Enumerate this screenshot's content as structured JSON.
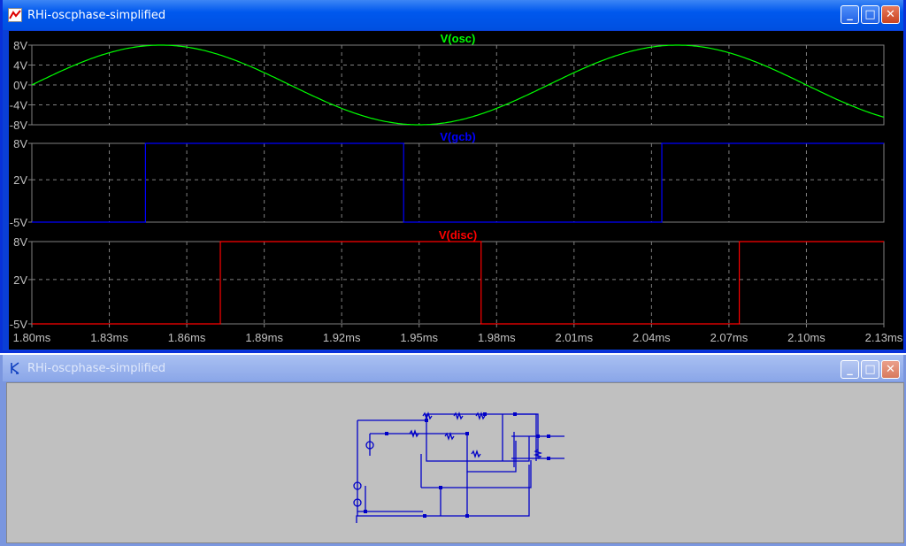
{
  "windows": {
    "waveform": {
      "title": "RHi-oscphase-simplified"
    },
    "schematic": {
      "title": "RHi-oscphase-simplified"
    }
  },
  "window_buttons": {
    "minimize": "_",
    "maximize": "□",
    "close": "✕"
  },
  "colors": {
    "grid": "#808080",
    "osc": "#00ff00",
    "gcb": "#0000ff",
    "disc": "#ff0000",
    "wire": "#0000c8"
  },
  "chart_data": {
    "type": "line",
    "xlim": [
      1.8,
      2.13
    ],
    "x_ticks": [
      "1.80ms",
      "1.83ms",
      "1.86ms",
      "1.89ms",
      "1.92ms",
      "1.95ms",
      "1.98ms",
      "2.01ms",
      "2.04ms",
      "2.07ms",
      "2.10ms",
      "2.13ms"
    ],
    "x_tick_values": [
      1.8,
      1.83,
      1.86,
      1.89,
      1.92,
      1.95,
      1.98,
      2.01,
      2.04,
      2.07,
      2.1,
      2.13
    ],
    "panels": [
      {
        "name": "V(osc)",
        "color": "#00ff00",
        "ylim": [
          -8,
          8
        ],
        "y_ticks": [
          "8V",
          "4V",
          "0V",
          "-4V",
          "-8V"
        ],
        "y_tick_values": [
          8,
          4,
          0,
          -4,
          -8
        ],
        "kind": "sine",
        "amplitude": 8,
        "period_ms": 0.2,
        "zero_cross_ms": 1.8
      },
      {
        "name": "V(gcb)",
        "color": "#0000ff",
        "ylim": [
          -5,
          8
        ],
        "y_ticks": [
          "8V",
          "2V",
          "-5V"
        ],
        "y_tick_values": [
          8,
          2,
          -5
        ],
        "kind": "square",
        "low": -5,
        "high": 8,
        "edges_ms": [
          [
            1.844,
            "up"
          ],
          [
            1.944,
            "down"
          ],
          [
            2.044,
            "up"
          ]
        ],
        "initial": -5
      },
      {
        "name": "V(disc)",
        "color": "#ff0000",
        "ylim": [
          -5,
          8
        ],
        "y_ticks": [
          "8V",
          "2V",
          "-5V"
        ],
        "y_tick_values": [
          8,
          2,
          -5
        ],
        "kind": "square",
        "low": -5,
        "high": 8,
        "edges_ms": [
          [
            1.873,
            "up"
          ],
          [
            1.974,
            "down"
          ],
          [
            2.074,
            "up"
          ]
        ],
        "initial": -5
      }
    ]
  }
}
